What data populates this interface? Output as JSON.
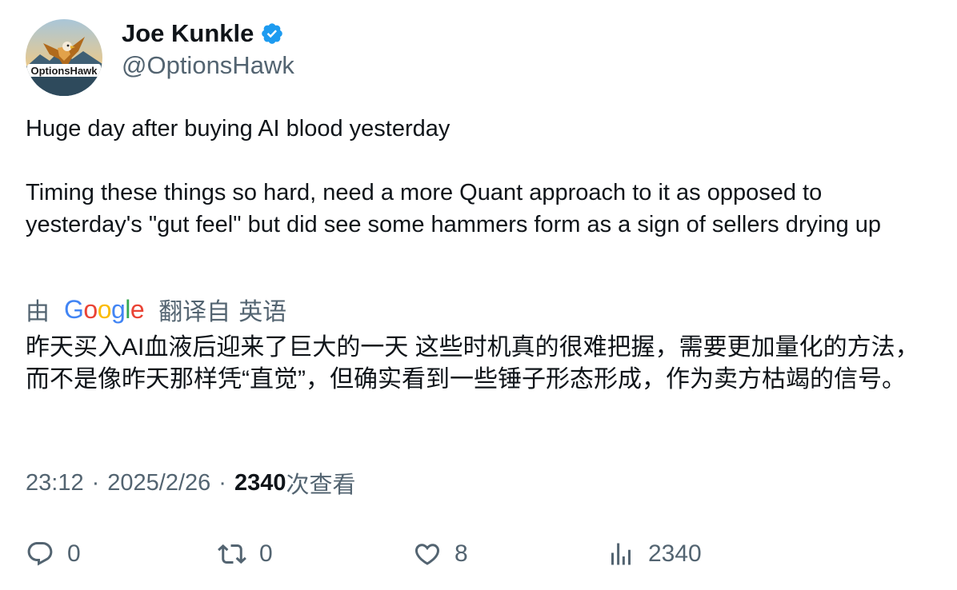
{
  "author": {
    "display_name": "Joe Kunkle",
    "handle": "@OptionsHawk",
    "avatar_text": "OptionsHawk",
    "verified_icon": "verified-badge-icon",
    "colors": {
      "verified": "#1d9bf0"
    }
  },
  "tweet": {
    "text": "Huge day after buying AI blood yesterday\n\nTiming these things so hard, need a more Quant approach to it as opposed to yesterday's \"gut feel\" but did see some hammers form as a sign of sellers drying up"
  },
  "translation": {
    "by_label": "由",
    "google_letters": [
      "G",
      "o",
      "o",
      "g",
      "l",
      "e"
    ],
    "translated_from_label": "翻译自",
    "language": "英语",
    "text": "昨天买入AI血液后迎来了巨大的一天 这些时机真的很难把握，需要更加量化的方法，而不是像昨天那样凭“直觉”，但确实看到一些锤子形态形成，作为卖方枯竭的信号。"
  },
  "meta": {
    "time": "23:12",
    "separator": "·",
    "date": "2025/2/26",
    "views_count": "2340",
    "views_label": "次查看"
  },
  "actions": {
    "reply": {
      "icon": "reply-icon",
      "count": "0"
    },
    "retweet": {
      "icon": "retweet-icon",
      "count": "0"
    },
    "like": {
      "icon": "heart-icon",
      "count": "8"
    },
    "views": {
      "icon": "analytics-icon",
      "count": "2340"
    }
  },
  "colors": {
    "text": "#0f1419",
    "secondary": "#536471",
    "background": "#ffffff"
  }
}
